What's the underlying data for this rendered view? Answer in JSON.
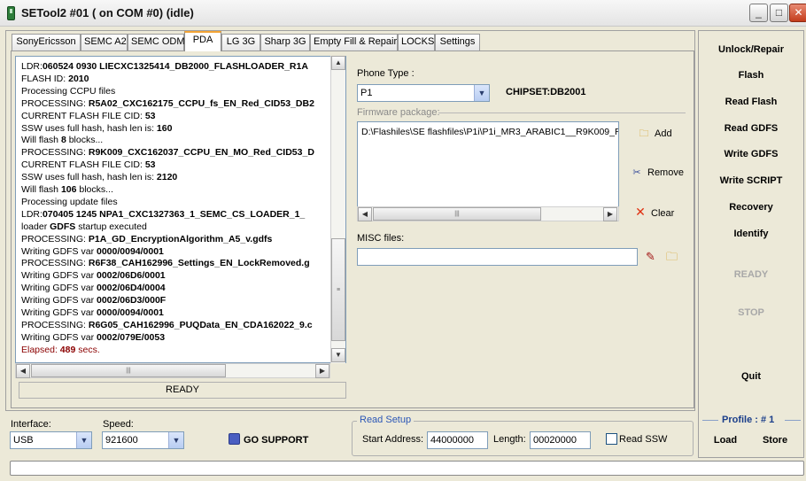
{
  "window": {
    "title": "SETool2 #01 ( on COM #0) (idle)",
    "minimize": "_",
    "maximize": "□",
    "close": "✕"
  },
  "tabs": [
    "SonyEricsson",
    "SEMC A2",
    "SEMC ODM",
    "PDA",
    "LG 3G",
    "Sharp 3G",
    "Empty Fill & Repair",
    "LOCKS",
    "Settings"
  ],
  "active_tab": "PDA",
  "log": {
    "lines": [
      {
        "p": "LDR:",
        "b": "060524 0930 LIECXC1325414_DB2000_FLASHLOADER_R1A",
        "s": ""
      },
      {
        "p": "FLASH ID: ",
        "b": "2010",
        "s": ""
      },
      {
        "p": "Processing CCPU files",
        "b": "",
        "s": ""
      },
      {
        "p": "PROCESSING: ",
        "b": "R5A02_CXC162175_CCPU_fs_EN_Red_CID53_DB2",
        "s": ""
      },
      {
        "p": "CURRENT FLASH FILE CID: ",
        "b": "53",
        "s": ""
      },
      {
        "p": "SSW uses full hash, hash len is: ",
        "b": "160",
        "s": ""
      },
      {
        "p": "Will flash ",
        "b": "8",
        "s": " blocks..."
      },
      {
        "p": "PROCESSING: ",
        "b": "R9K009_CXC162037_CCPU_EN_MO_Red_CID53_D",
        "s": ""
      },
      {
        "p": "CURRENT FLASH FILE CID: ",
        "b": "53",
        "s": ""
      },
      {
        "p": "SSW uses full hash, hash len is: ",
        "b": "2120",
        "s": ""
      },
      {
        "p": "Will flash ",
        "b": "106",
        "s": " blocks..."
      },
      {
        "p": "Processing update files",
        "b": "",
        "s": ""
      },
      {
        "p": "LDR:",
        "b": "070405 1245 NPA1_CXC1327363_1_SEMC_CS_LOADER_1_",
        "s": ""
      },
      {
        "p": "loader ",
        "b": "GDFS",
        "s": " startup executed"
      },
      {
        "p": "PROCESSING: ",
        "b": "P1A_GD_EncryptionAlgorithm_A5_v.gdfs",
        "s": ""
      },
      {
        "p": "Writing GDFS var ",
        "b": "0000/0094/0001",
        "s": ""
      },
      {
        "p": "PROCESSING: ",
        "b": "R6F38_CAH162996_Settings_EN_LockRemoved.g",
        "s": ""
      },
      {
        "p": "Writing GDFS var ",
        "b": "0002/06D6/0001",
        "s": ""
      },
      {
        "p": "Writing GDFS var ",
        "b": "0002/06D4/0004",
        "s": ""
      },
      {
        "p": "Writing GDFS var ",
        "b": "0002/06D3/000F",
        "s": ""
      },
      {
        "p": "Writing GDFS var ",
        "b": "0000/0094/0001",
        "s": ""
      },
      {
        "p": "PROCESSING: ",
        "b": "R6G05_CAH162996_PUQData_EN_CDA162022_9.c",
        "s": ""
      },
      {
        "p": "Writing GDFS var ",
        "b": "0002/079E/0053",
        "s": ""
      },
      {
        "p": "Elapsed: ",
        "b": "489",
        "s": " secs."
      }
    ],
    "status": "READY"
  },
  "pda": {
    "phone_type_label": "Phone Type :",
    "phone_type_value": "P1",
    "chipset": "CHIPSET:DB2001",
    "firmware_label": "Firmware package:",
    "firmware_item": "D:\\Flashiles\\SE flashfiles\\P1i\\P1i_MR3_ARABIC1__R9K009_R",
    "add_label": "Add",
    "remove_label": "Remove",
    "clear_label": "Clear",
    "misc_label": "MISC files:",
    "misc_value": ""
  },
  "right_buttons": {
    "unlock": "Unlock/Repair",
    "flash": "Flash",
    "read_flash": "Read Flash",
    "read_gdfs": "Read GDFS",
    "write_gdfs": "Write GDFS",
    "write_script": "Write SCRIPT",
    "recovery": "Recovery",
    "identify": "Identify",
    "ready": "READY",
    "stop": "STOP",
    "quit": "Quit",
    "profile": "Profile : # 1",
    "load": "Load",
    "store": "Store"
  },
  "bottom": {
    "interface_label": "Interface:",
    "interface_value": "USB",
    "speed_label": "Speed:",
    "speed_value": "921600",
    "go_support": "GO SUPPORT",
    "read_setup_title": "Read Setup",
    "start_address_label": "Start Address:",
    "start_address_value": "44000000",
    "length_label": "Length:",
    "length_value": "00020000",
    "read_ssw_label": "Read SSW",
    "read_ssw_checked": false
  },
  "progress": 0,
  "colors": {
    "accent_tab": "#f3a436",
    "elapsed": "#8b0000",
    "group_title": "#2b56b6",
    "profile": "#1a3e8a",
    "close_button": "#c33d1c"
  },
  "icons": {
    "add": "folder-open-icon",
    "remove": "scissors-icon",
    "clear": "red-x-icon",
    "misc_edit": "pen-icon",
    "misc_open": "folder-open-icon",
    "go_support": "support-globe-icon"
  }
}
